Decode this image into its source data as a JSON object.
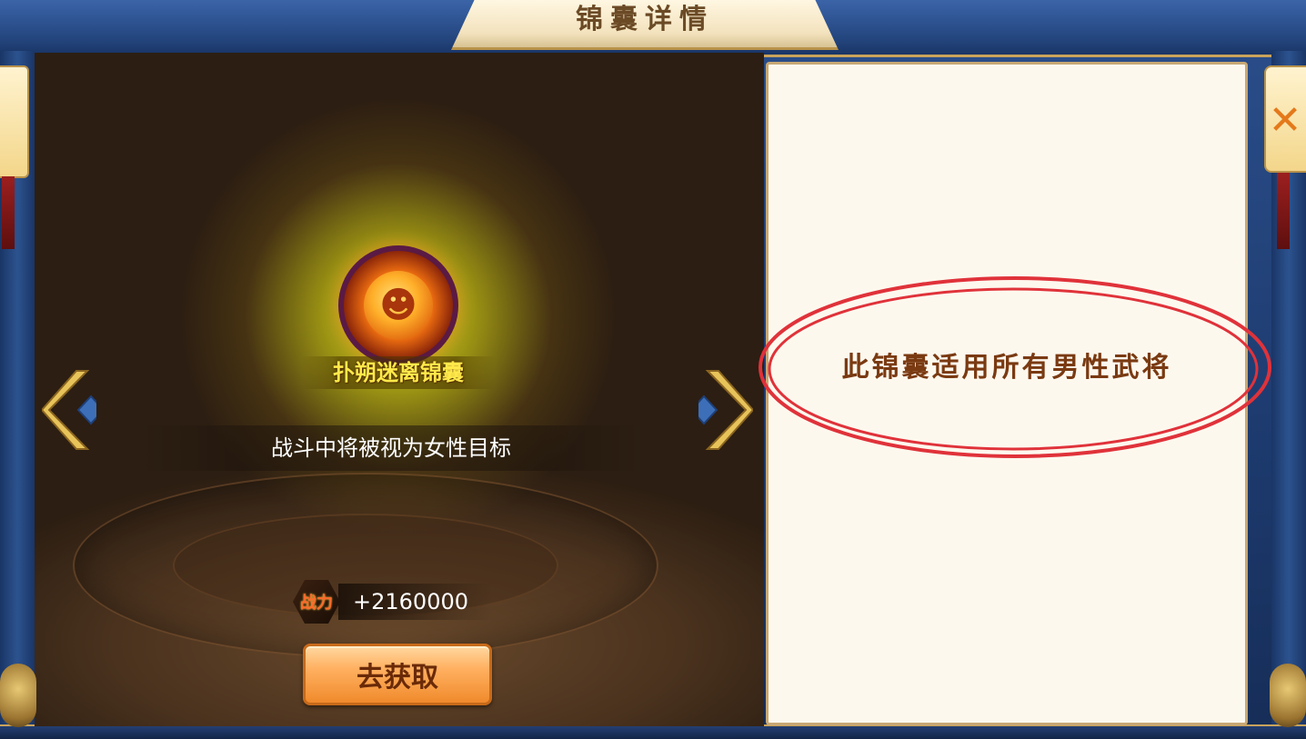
{
  "dialog": {
    "title": "锦囊详情"
  },
  "item": {
    "name": "扑朔迷离锦囊",
    "description": "战斗中将被视为女性目标",
    "power_badge": "战力",
    "power_value": "+2160000",
    "get_button_label": "去获取"
  },
  "info_card": {
    "text": "此锦囊适用所有男性武将"
  },
  "icons": {
    "close": "close-icon",
    "prev": "arrow-left-icon",
    "next": "arrow-right-icon"
  },
  "colors": {
    "frame_blue": "#2b4f8c",
    "gold_trim": "#c9a35a",
    "item_name": "#ffe94a",
    "button_orange": "#f08a2c",
    "info_text": "#7a3a12",
    "annotation_red": "#e0323a"
  }
}
